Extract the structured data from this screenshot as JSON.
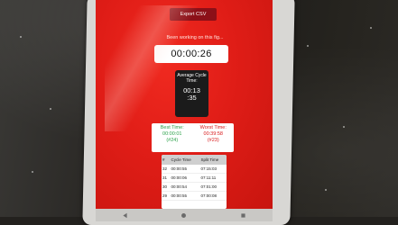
{
  "toolbar": {
    "export_label": "Export CSV"
  },
  "timer": {
    "working_text": "Been working on this fig...",
    "elapsed": "00:00:26"
  },
  "average": {
    "label": "Average Cycle Time:",
    "value_line1": "00:13",
    "value_line2": ":35"
  },
  "best": {
    "label": "Best Time:",
    "value": "00:00:01",
    "index": "(#24)"
  },
  "worst": {
    "label": "Worst Time:",
    "value": "00:39:58",
    "index": "(#23)"
  },
  "cycle_table": {
    "headers": [
      "#",
      "Cycle Time",
      "Split Time"
    ],
    "rows": [
      [
        "32",
        "00:00:55",
        "07:15:03"
      ],
      [
        "31",
        "00:00:06",
        "07:11:11"
      ],
      [
        "30",
        "00:00:54",
        "07:01:00"
      ],
      [
        "29",
        "00:00:55",
        "07:00:08"
      ]
    ]
  },
  "nav": {
    "icons": [
      "back-icon",
      "home-icon",
      "recents-icon"
    ]
  },
  "colors": {
    "screen_red": "#e01d17",
    "export_button": "#8c1018",
    "best_green": "#2ca24a",
    "worst_red": "#d8181a"
  }
}
